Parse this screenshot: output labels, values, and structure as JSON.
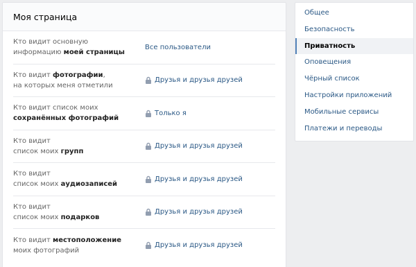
{
  "main": {
    "title": "Моя страница",
    "rows": [
      {
        "label_plain_1": "Кто видит основную",
        "label_plain_2": "информацию ",
        "label_bold": "моей страницы",
        "value": "Все пользователи",
        "locked": false
      },
      {
        "label_plain_1": "Кто видит ",
        "label_bold_1": "фотографии",
        "label_tail_1": ",",
        "label_plain_2": "на которых меня отметили",
        "value": "Друзья и друзья друзей",
        "locked": true
      },
      {
        "label_plain_1": "Кто видит список моих",
        "label_bold_2": "сохранённых фотографий",
        "value": "Только я",
        "locked": true
      },
      {
        "label_plain_1": "Кто видит",
        "label_plain_2": "список моих ",
        "label_bold_2": "групп",
        "value": "Друзья и друзья друзей",
        "locked": true
      },
      {
        "label_plain_1": "Кто видит",
        "label_plain_2": "список моих ",
        "label_bold_2": "аудиозаписей",
        "value": "Друзья и друзья друзей",
        "locked": true
      },
      {
        "label_plain_1": "Кто видит",
        "label_plain_2": "список моих ",
        "label_bold_2": "подарков",
        "value": "Друзья и друзья друзей",
        "locked": true
      },
      {
        "label_plain_1": "Кто видит ",
        "label_bold_1": "местоположение",
        "label_plain_2": "моих фотографий",
        "value": "Друзья и друзья друзей",
        "locked": true
      }
    ]
  },
  "sidebar": {
    "items": [
      {
        "label": "Общее",
        "active": false
      },
      {
        "label": "Безопасность",
        "active": false
      },
      {
        "label": "Приватность",
        "active": true
      },
      {
        "label": "Оповещения",
        "active": false
      },
      {
        "label": "Чёрный список",
        "active": false
      },
      {
        "label": "Настройки приложений",
        "active": false
      },
      {
        "label": "Мобильные сервисы",
        "active": false
      },
      {
        "label": "Платежи и переводы",
        "active": false
      }
    ]
  },
  "colors": {
    "link": "#2a5885",
    "accent": "#5181b8",
    "background": "#edeef0"
  }
}
